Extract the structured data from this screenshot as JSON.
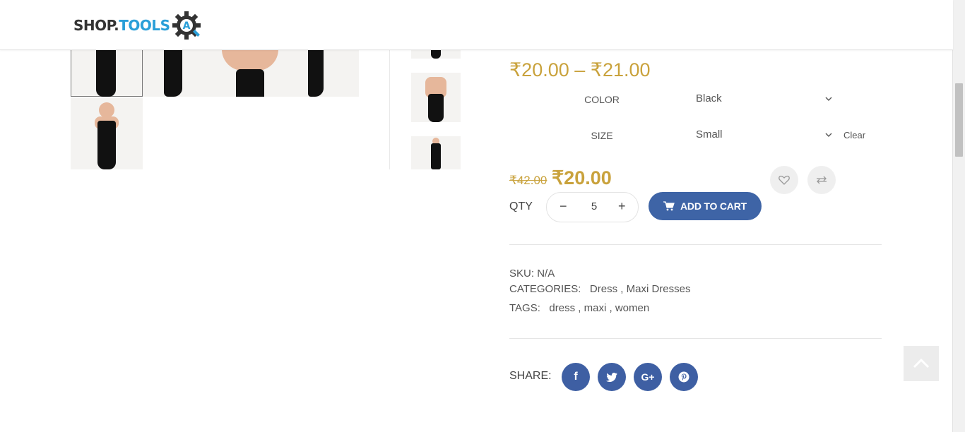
{
  "header": {
    "logo_part1": "SHOP.",
    "logo_part2": "TOOLS",
    "logo_badge": "A"
  },
  "product": {
    "price_range": "₹20.00 – ₹21.00",
    "attributes": [
      {
        "label": "COLOR",
        "value": "Black"
      },
      {
        "label": "SIZE",
        "value": "Small"
      }
    ],
    "clear_label": "Clear",
    "old_price": "₹42.00",
    "new_price": "₹20.00",
    "qty_label": "QTY",
    "qty_value": "5",
    "qty_minus": "−",
    "qty_plus": "+",
    "add_to_cart": "ADD TO CART",
    "sku_label": "SKU:",
    "sku_value": "N/A",
    "categories_label": "CATEGORIES:",
    "categories": [
      "Dress",
      "Maxi Dresses"
    ],
    "tags_label": "TAGS:",
    "tags": [
      "dress",
      "maxi",
      "women"
    ],
    "share_label": "SHARE:"
  },
  "social": {
    "facebook": "f",
    "googleplus": "G+"
  },
  "colors": {
    "accent_price": "#c9a23c",
    "button_blue": "#3e64a6",
    "social_blue": "#3e5fa3"
  },
  "icons": [
    "heart-icon",
    "compare-arrows-icon",
    "cart-icon",
    "twitter-icon",
    "pinterest-icon",
    "chevron-up-icon",
    "chevron-down-icon"
  ]
}
